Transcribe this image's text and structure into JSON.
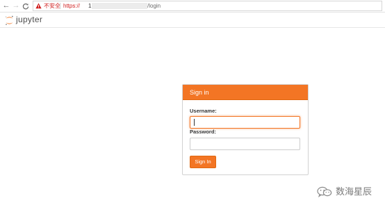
{
  "browser": {
    "security_label": "不安全",
    "url_scheme": "https://",
    "url_host": "1",
    "url_path": "/login",
    "nav_back_glyph": "←",
    "nav_forward_glyph": "→",
    "nav_reload_glyph": "C",
    "warning_color": "#d01e1e"
  },
  "header": {
    "logo_text": "jupyter",
    "logo_icon": "jupyter-logo-icon"
  },
  "login": {
    "title": "Sign in",
    "username_label": "Username:",
    "username_value": "",
    "password_label": "Password:",
    "password_value": "",
    "submit_label": "Sign In",
    "accent_color": "#f37524"
  },
  "watermark": {
    "text": "数海星辰",
    "icon": "wechat-icon"
  }
}
